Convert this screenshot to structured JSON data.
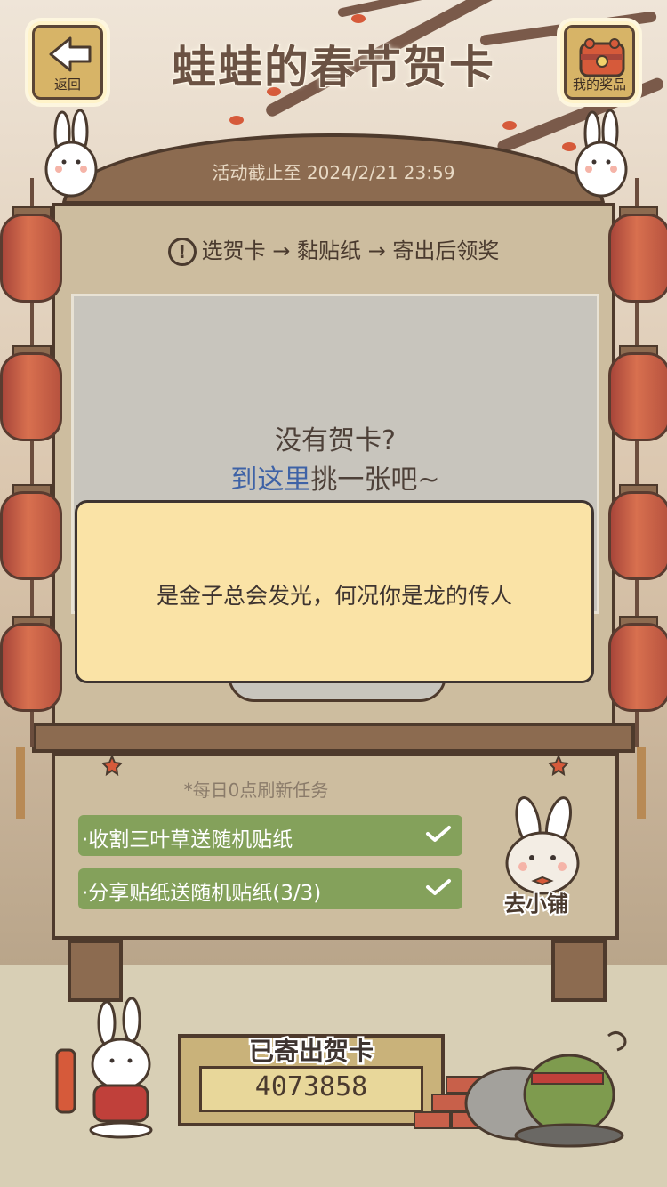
{
  "header": {
    "back_label": "返回",
    "title": "蛙蛙的春节贺卡",
    "prizes_label": "我的奖品"
  },
  "event": {
    "deadline": "活动截止至 2024/2/21 23:59",
    "steps_icon": "!",
    "steps": "选贺卡 → 黏贴纸 → 寄出后领奖"
  },
  "card_area": {
    "empty_line1": "没有贺卡?",
    "link_text": "到这里",
    "link_suffix": "挑一张吧~"
  },
  "toast": {
    "message": "是金子总会发光，何况你是龙的传人"
  },
  "tasks": {
    "refresh_note": "*每日0点刷新任务",
    "items": [
      {
        "label": "·收割三叶草送随机贴纸",
        "done": true
      },
      {
        "label": "·分享贴纸送随机贴纸(3/3)",
        "done": true
      }
    ]
  },
  "shop": {
    "label": "去小铺"
  },
  "sent": {
    "label": "已寄出贺卡",
    "count": "4073858"
  },
  "colors": {
    "board_wood": "#8c6b50",
    "outline": "#4e3a2c",
    "toast_bg": "#fae3a6",
    "task_green": "#84a15b",
    "link_blue": "#3e62a6",
    "lantern_red": "#c55e46"
  }
}
